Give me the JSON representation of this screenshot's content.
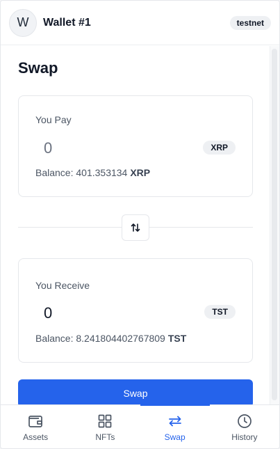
{
  "header": {
    "avatar_letter": "W",
    "wallet_name": "Wallet #1",
    "network_badge": "testnet"
  },
  "main": {
    "title": "Swap",
    "pay_card": {
      "label": "You Pay",
      "amount": "0",
      "token": "XRP",
      "balance_label": "Balance: 401.353134",
      "balance_symbol": "XRP"
    },
    "switch_icon": "arrows-up-down-icon",
    "receive_card": {
      "label": "You Receive",
      "amount": "0",
      "token": "TST",
      "balance_label": "Balance: 8.241804402767809",
      "balance_symbol": "TST"
    },
    "swap_button": "Swap"
  },
  "bottom_nav": {
    "items": [
      {
        "label": "Assets",
        "icon": "wallet-icon",
        "active": false
      },
      {
        "label": "NFTs",
        "icon": "grid-icon",
        "active": false
      },
      {
        "label": "Swap",
        "icon": "swap-arrows-icon",
        "active": true
      },
      {
        "label": "History",
        "icon": "clock-icon",
        "active": false
      }
    ]
  },
  "colors": {
    "accent": "#2563eb",
    "badge_bg": "#eef0f3",
    "text_muted": "#4b5563"
  }
}
